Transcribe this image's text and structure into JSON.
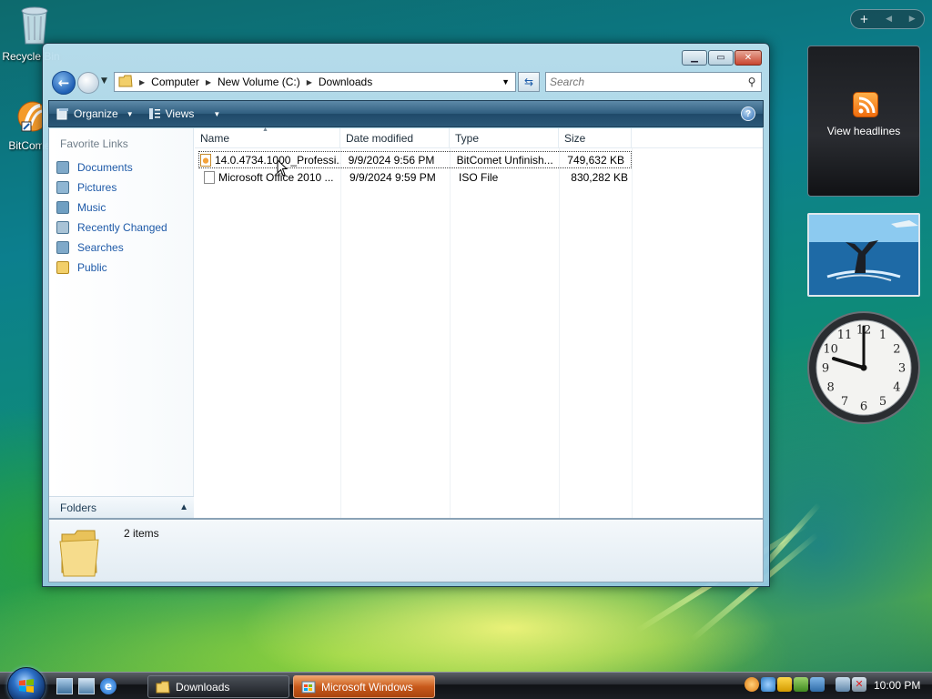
{
  "desktop": {
    "icons": [
      {
        "label": "Recycle Bin",
        "icon": "recycle-bin-icon"
      },
      {
        "label": "BitComet",
        "icon": "bitcomet-icon"
      }
    ]
  },
  "window": {
    "title_buttons": {
      "minimize": "minimize-icon",
      "maximize": "maximize-icon",
      "close": "close-icon"
    },
    "address": {
      "breadcrumbs": [
        "Computer",
        "New Volume (C:)",
        "Downloads"
      ]
    },
    "search": {
      "placeholder": "Search"
    },
    "toolbar": {
      "organize_label": "Organize",
      "views_label": "Views"
    },
    "left_pane": {
      "title": "Favorite Links",
      "items": [
        {
          "label": "Documents",
          "icon": "documents-icon"
        },
        {
          "label": "Pictures",
          "icon": "pictures-icon"
        },
        {
          "label": "Music",
          "icon": "music-icon"
        },
        {
          "label": "Recently Changed",
          "icon": "recently-changed-icon"
        },
        {
          "label": "Searches",
          "icon": "searches-icon"
        },
        {
          "label": "Public",
          "icon": "public-folder-icon"
        }
      ],
      "folders_label": "Folders"
    },
    "file_list": {
      "columns": [
        "Name",
        "Date modified",
        "Type",
        "Size"
      ],
      "rows": [
        {
          "name": "14.0.4734.1000_Professi...",
          "date": "9/9/2024 9:56 PM",
          "type": "BitComet Unfinish...",
          "size": "749,632 KB"
        },
        {
          "name": "Microsoft Office 2010 ...",
          "date": "9/9/2024 9:59 PM",
          "type": "ISO File",
          "size": "830,282 KB"
        }
      ]
    },
    "details": {
      "items_count": "2 items"
    }
  },
  "sidebar": {
    "feed_gadget_label": "View headlines",
    "clock_numbers": [
      "12",
      "1",
      "2",
      "3",
      "4",
      "5",
      "6",
      "7",
      "8",
      "9",
      "10",
      "11"
    ]
  },
  "taskbar": {
    "buttons": [
      {
        "label": "Downloads",
        "state": "active"
      },
      {
        "label": "Microsoft Windows",
        "state": "flashing"
      }
    ],
    "clock": "10:00 PM"
  },
  "colors": {
    "link_blue": "#1e5aa8",
    "toolbar_dark": "#2b5878",
    "flash_orange": "#c85a1b"
  }
}
